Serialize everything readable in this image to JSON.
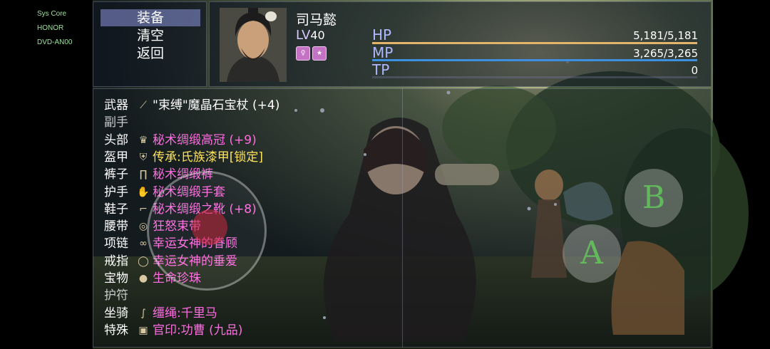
{
  "system": {
    "lines": [
      "Sys Core",
      "HONOR",
      "DVD-AN00"
    ]
  },
  "menu": {
    "items": [
      "装备",
      "清空",
      "返回"
    ],
    "active_index": 0
  },
  "hero": {
    "name": "司马懿",
    "level_prefix": "LV",
    "level": "40",
    "badges": [
      "person-badge-icon",
      "seal-badge-icon"
    ],
    "stats": [
      {
        "label": "HP",
        "value": "5,181/5,181",
        "fill": 1.0,
        "color": "#e2b56a"
      },
      {
        "label": "MP",
        "value": "3,265/3,265",
        "fill": 1.0,
        "color": "#3d8fe0"
      },
      {
        "label": "TP",
        "value": "0",
        "fill": 0.0,
        "color": "#7b5fd1"
      }
    ]
  },
  "equipment": [
    {
      "slot": "武器",
      "item": "\"束缚\"魔晶石宝杖 (+4)",
      "color": "#ffffff",
      "icon": "staff-icon"
    },
    {
      "slot": "副手",
      "item": "",
      "color": "#ffffff",
      "icon": ""
    },
    {
      "slot": "头部",
      "item": "秘术绸缎高冠 (+9)",
      "color": "#ff6be0",
      "icon": "crown-icon"
    },
    {
      "slot": "盔甲",
      "item": "传承:氏族漆甲[锁定]",
      "color": "#ffe35a",
      "icon": "armor-icon"
    },
    {
      "slot": "裤子",
      "item": "秘术绸缎裤",
      "color": "#ff6be0",
      "icon": "pants-icon"
    },
    {
      "slot": "护手",
      "item": "秘术绸缎手套",
      "color": "#ff6be0",
      "icon": "gloves-icon"
    },
    {
      "slot": "鞋子",
      "item": "秘术绸缎之靴 (+8)",
      "color": "#ff6be0",
      "icon": "boots-icon"
    },
    {
      "slot": "腰带",
      "item": "狂怒束带",
      "color": "#ff6be0",
      "icon": "belt-icon"
    },
    {
      "slot": "项链",
      "item": "幸运女神的眷顾",
      "color": "#ff6be0",
      "icon": "necklace-icon"
    },
    {
      "slot": "戒指",
      "item": "幸运女神的垂爱",
      "color": "#ff6be0",
      "icon": "ring-icon"
    },
    {
      "slot": "宝物",
      "item": "生命珍珠",
      "color": "#ff6be0",
      "icon": "pearl-icon"
    },
    {
      "slot": "护符",
      "item": "",
      "color": "#ffffff",
      "icon": ""
    },
    {
      "slot": "坐骑",
      "item": "缰绳:千里马",
      "color": "#ff6be0",
      "icon": "reins-icon"
    },
    {
      "slot": "特殊",
      "item": "官印:功曹 (九品)",
      "color": "#ff6be0",
      "icon": "seal-icon"
    }
  ],
  "controls": {
    "button_b": "B",
    "button_a": "A"
  }
}
